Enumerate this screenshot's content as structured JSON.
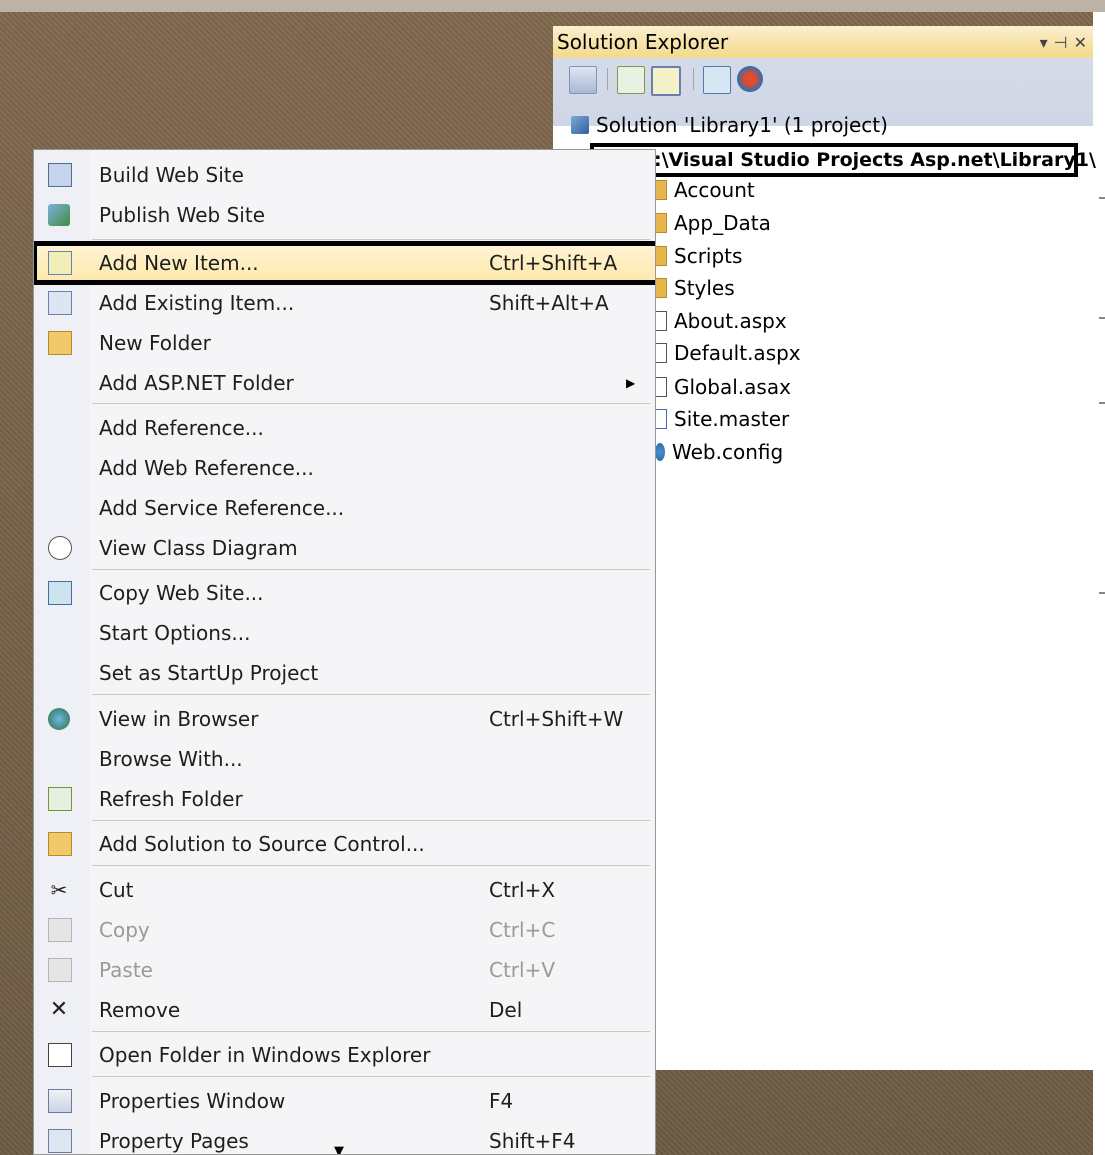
{
  "solution_explorer": {
    "title": "Solution Explorer",
    "controls": [
      "▾",
      "⊣",
      "✕"
    ],
    "solution_label": "Solution 'Library1' (1 project)",
    "project_path": ":\\Visual Studio Projects Asp.net\\Library1\\",
    "items": [
      {
        "label": "Account",
        "icon": "folder-icon"
      },
      {
        "label": "App_Data",
        "icon": "folder-icon"
      },
      {
        "label": "Scripts",
        "icon": "folder-icon"
      },
      {
        "label": "Styles",
        "icon": "folder-icon"
      },
      {
        "label": "About.aspx",
        "icon": "aspx-file-icon"
      },
      {
        "label": "Default.aspx",
        "icon": "aspx-file-icon"
      },
      {
        "label": "Global.asax",
        "icon": "asax-file-icon"
      },
      {
        "label": "Site.master",
        "icon": "master-file-icon"
      },
      {
        "label": "Web.config",
        "icon": "config-file-icon"
      }
    ]
  },
  "context_menu": {
    "items": [
      {
        "label": "Build Web Site",
        "shortcut": "",
        "icon": "build-icon"
      },
      {
        "label": "Publish Web Site",
        "shortcut": "",
        "icon": "publish-icon"
      },
      {
        "label": "Add New Item...",
        "shortcut": "Ctrl+Shift+A",
        "icon": "add-new-item-icon",
        "highlighted": true
      },
      {
        "label": "Add Existing Item...",
        "shortcut": "Shift+Alt+A",
        "icon": "add-existing-item-icon"
      },
      {
        "label": "New Folder",
        "shortcut": "",
        "icon": "new-folder-icon"
      },
      {
        "label": "Add ASP.NET Folder",
        "shortcut": "",
        "submenu": true
      },
      {
        "label": "Add Reference...",
        "shortcut": ""
      },
      {
        "label": "Add Web Reference...",
        "shortcut": ""
      },
      {
        "label": "Add Service Reference...",
        "shortcut": ""
      },
      {
        "label": "View Class Diagram",
        "shortcut": "",
        "icon": "class-diagram-icon"
      },
      {
        "label": "Copy Web Site...",
        "shortcut": "",
        "icon": "copy-web-site-icon"
      },
      {
        "label": "Start Options...",
        "shortcut": ""
      },
      {
        "label": "Set as StartUp Project",
        "shortcut": ""
      },
      {
        "label": "View in Browser",
        "shortcut": "Ctrl+Shift+W",
        "icon": "view-in-browser-icon"
      },
      {
        "label": "Browse With...",
        "shortcut": ""
      },
      {
        "label": "Refresh Folder",
        "shortcut": "",
        "icon": "refresh-icon"
      },
      {
        "label": "Add Solution to Source Control...",
        "shortcut": "",
        "icon": "source-control-icon"
      },
      {
        "label": "Cut",
        "shortcut": "Ctrl+X",
        "icon": "cut-icon"
      },
      {
        "label": "Copy",
        "shortcut": "Ctrl+C",
        "icon": "copy-icon",
        "disabled": true
      },
      {
        "label": "Paste",
        "shortcut": "Ctrl+V",
        "icon": "paste-icon",
        "disabled": true
      },
      {
        "label": "Remove",
        "shortcut": "Del",
        "icon": "remove-icon"
      },
      {
        "label": "Open Folder in Windows Explorer",
        "shortcut": "",
        "icon": "open-folder-icon"
      },
      {
        "label": "Properties Window",
        "shortcut": "F4",
        "icon": "properties-icon"
      },
      {
        "label": "Property Pages",
        "shortcut": "Shift+F4",
        "icon": "property-pages-icon"
      }
    ]
  }
}
